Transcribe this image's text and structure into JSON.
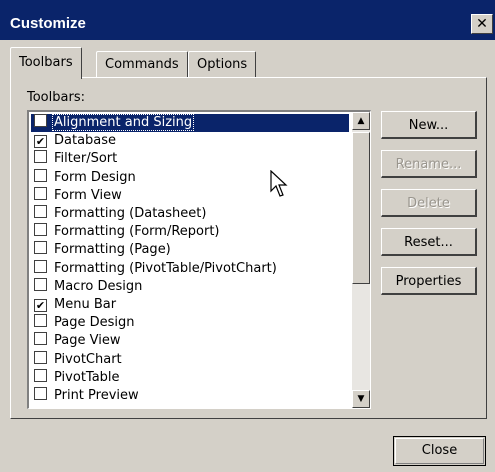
{
  "window": {
    "title": "Customize",
    "close_glyph": "✕"
  },
  "tabs": [
    {
      "label": "Toolbars",
      "active": true
    },
    {
      "label": "Commands",
      "active": false
    },
    {
      "label": "Options",
      "active": false
    }
  ],
  "toolbars_label": "Toolbars:",
  "toolbars": [
    {
      "label": "Alignment and Sizing",
      "checked": false,
      "selected": true
    },
    {
      "label": "Database",
      "checked": true
    },
    {
      "label": "Filter/Sort",
      "checked": false
    },
    {
      "label": "Form Design",
      "checked": false
    },
    {
      "label": "Form View",
      "checked": false
    },
    {
      "label": "Formatting (Datasheet)",
      "checked": false
    },
    {
      "label": "Formatting (Form/Report)",
      "checked": false
    },
    {
      "label": "Formatting (Page)",
      "checked": false
    },
    {
      "label": "Formatting (PivotTable/PivotChart)",
      "checked": false
    },
    {
      "label": "Macro Design",
      "checked": false
    },
    {
      "label": "Menu Bar",
      "checked": true
    },
    {
      "label": "Page Design",
      "checked": false
    },
    {
      "label": "Page View",
      "checked": false
    },
    {
      "label": "PivotChart",
      "checked": false
    },
    {
      "label": "PivotTable",
      "checked": false
    },
    {
      "label": "Print Preview",
      "checked": false
    }
  ],
  "buttons": {
    "new": "New...",
    "rename": "Rename...",
    "delete": "Delete",
    "reset": "Reset...",
    "properties": "Properties",
    "close": "Close"
  },
  "icons": {
    "check": "✔",
    "scroll_up": "▲",
    "scroll_down": "▼",
    "cursor": "mouse-pointer-icon"
  }
}
